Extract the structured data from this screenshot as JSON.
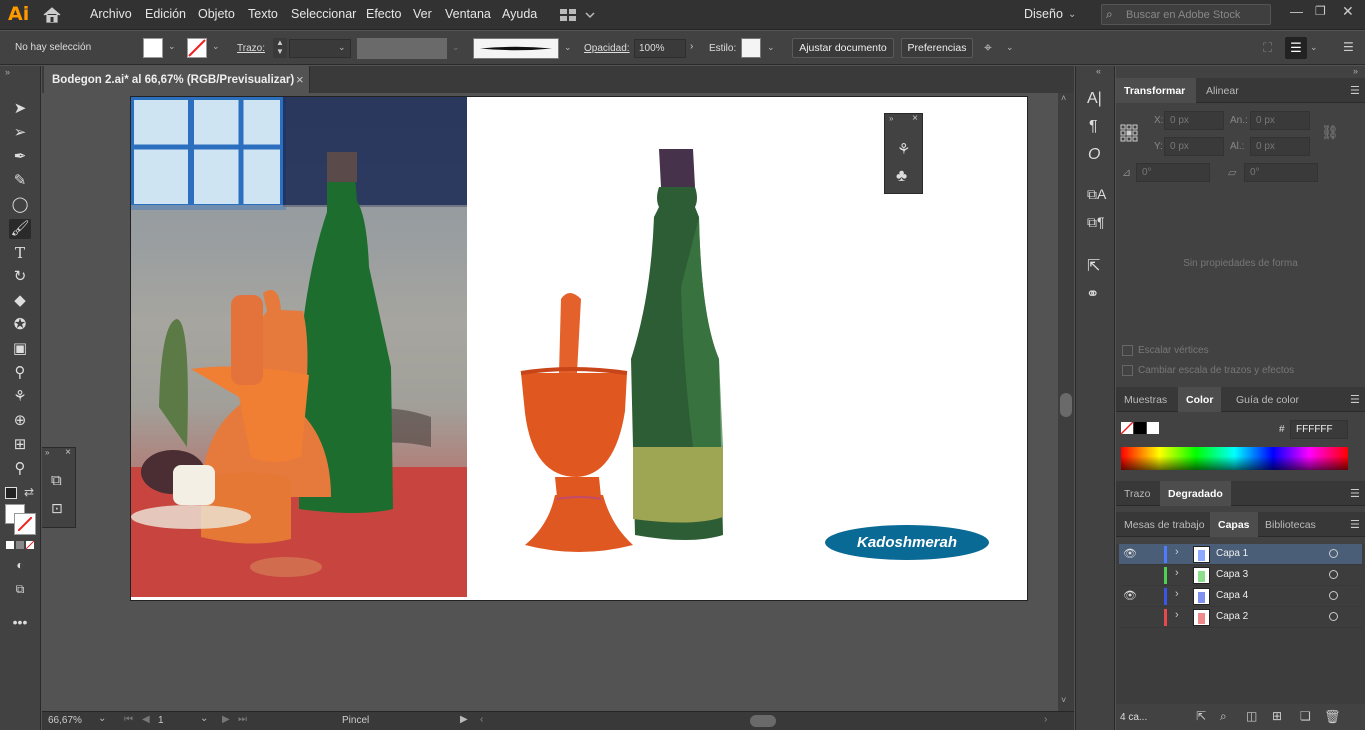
{
  "app": {
    "logo": "Ai"
  },
  "menu": [
    "Archivo",
    "Edición",
    "Objeto",
    "Texto",
    "Seleccionar",
    "Efecto",
    "Ver",
    "Ventana",
    "Ayuda"
  ],
  "workspace": {
    "label": "Diseño",
    "search_placeholder": "Buscar en Adobe Stock"
  },
  "control": {
    "selection": "No hay selección",
    "stroke_label": "Trazo:",
    "opacity_label": "Opacidad:",
    "opacity_value": "100%",
    "style_label": "Estilo:",
    "doc_button": "Ajustar documento",
    "prefs_button": "Preferencias"
  },
  "document": {
    "tab_title": "Bodegon 2.ai* al 66,67% (RGB/Previsualizar)",
    "close": "×"
  },
  "artwork": {
    "badge_text": "Kadoshmerah"
  },
  "status": {
    "zoom": "66,67%",
    "artboard": "1",
    "tool": "Pincel"
  },
  "transform_panel": {
    "tabs": [
      "Transformar",
      "Alinear"
    ],
    "x_label": "X:",
    "x_value": "0 px",
    "w_label": "An.:",
    "w_value": "0 px",
    "y_label": "Y:",
    "y_value": "0 px",
    "h_label": "Al.:",
    "h_value": "0 px",
    "rot_value": "0°",
    "shear_value": "0°",
    "no_props": "Sin propiedades de forma",
    "scale_corners": "Escalar vértices",
    "scale_strokes": "Cambiar escala de trazos y efectos"
  },
  "color_panel": {
    "tabs": [
      "Muestras",
      "Color",
      "Guía de color"
    ],
    "hash": "#",
    "hex": "FFFFFF"
  },
  "gradient_panel": {
    "tabs": [
      "Trazo",
      "Degradado"
    ]
  },
  "layers_panel": {
    "tabs": [
      "Mesas de trabajo",
      "Capas",
      "Bibliotecas"
    ],
    "layers": [
      {
        "name": "Capa 1",
        "color": "#4f7cff",
        "visible": true,
        "selected": true
      },
      {
        "name": "Capa 3",
        "color": "#4fd04f",
        "visible": false,
        "selected": false
      },
      {
        "name": "Capa 4",
        "color": "#3a56e8",
        "visible": true,
        "selected": false
      },
      {
        "name": "Capa 2",
        "color": "#e84a4a",
        "visible": false,
        "selected": false
      }
    ],
    "footer_count": "4 ca..."
  }
}
